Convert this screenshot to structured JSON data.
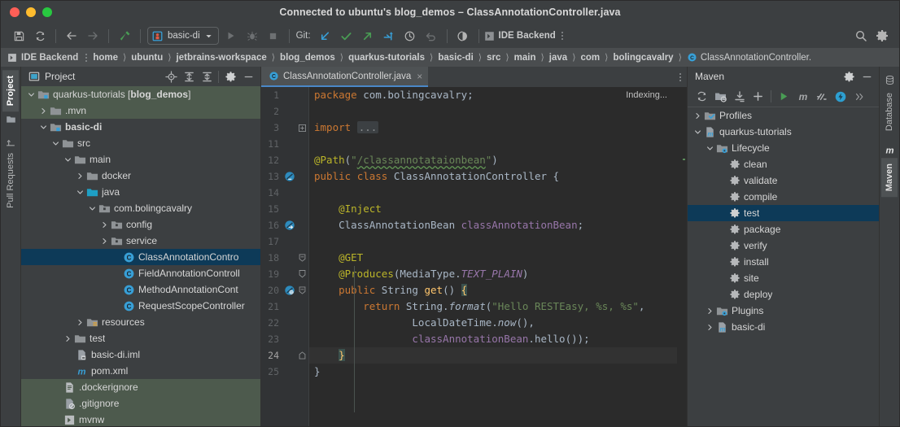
{
  "window": {
    "title": "Connected to ubuntu's blog_demos – ClassAnnotationController.java",
    "traffic_lights": [
      "close",
      "minimize",
      "zoom"
    ]
  },
  "toolbar": {
    "save_label": "save-all-icon",
    "sync_label": "sync-icon",
    "back_label": "back-arrow-icon",
    "forward_label": "forward-arrow-icon",
    "build_label": "build-hammer-icon",
    "run_config": "basic-di",
    "run_label": "run-icon",
    "debug_label": "debug-icon",
    "stop_label": "stop-icon",
    "git_label": "Git:",
    "git_update": "update-project-icon",
    "git_commit": "commit-icon",
    "git_push": "push-icon",
    "git_rebase": "rebase-icon",
    "history_label": "history-icon",
    "rollback_label": "rollback-icon",
    "coverage_label": "run-with-coverage-icon",
    "ide_backend": "IDE Backend",
    "search_label": "search-icon",
    "settings_label": "gear-icon"
  },
  "navbar": {
    "ide_backend": "IDE Backend",
    "crumbs": [
      {
        "label": "home",
        "bold": true
      },
      {
        "label": "ubuntu",
        "bold": true
      },
      {
        "label": "jetbrains-workspace",
        "bold": true
      },
      {
        "label": "blog_demos",
        "bold": true
      },
      {
        "label": "quarkus-tutorials",
        "bold": true
      },
      {
        "label": "basic-di",
        "bold": true
      },
      {
        "label": "src",
        "bold": true
      },
      {
        "label": "main",
        "bold": true
      },
      {
        "label": "java",
        "bold": true
      },
      {
        "label": "com",
        "bold": true
      },
      {
        "label": "bolingcavalry",
        "bold": true
      }
    ],
    "file": "ClassAnnotationController."
  },
  "left_strip": {
    "tabs": [
      {
        "label": "Project",
        "active": true,
        "icon": "project-icon"
      },
      {
        "label": "Pull Requests",
        "active": false,
        "icon": "pull-request-icon"
      }
    ]
  },
  "right_strip": {
    "tabs": [
      {
        "label": "Database",
        "active": false,
        "icon": "database-icon"
      },
      {
        "label": "Maven",
        "active": true,
        "icon": "maven-m-icon"
      }
    ]
  },
  "project_panel": {
    "title": "Project",
    "actions": [
      "locate-icon",
      "expand-all-icon",
      "collapse-all-icon",
      "gear-icon",
      "minimize-icon"
    ],
    "tree": [
      {
        "label": "quarkus-tutorials [blog_demos]",
        "bold_part": "blog_demos",
        "indent": 0,
        "arrow": "down",
        "icon": "module-folder-icon",
        "state": "modified"
      },
      {
        "label": ".mvn",
        "indent": 1,
        "arrow": "right",
        "icon": "folder-icon",
        "state": "modified"
      },
      {
        "label": "basic-di",
        "indent": 1,
        "arrow": "down",
        "icon": "module-folder-icon",
        "state": "bold"
      },
      {
        "label": "src",
        "indent": 2,
        "arrow": "down",
        "icon": "folder-icon",
        "state": "normal"
      },
      {
        "label": "main",
        "indent": 3,
        "arrow": "down",
        "icon": "folder-icon",
        "state": "normal"
      },
      {
        "label": "docker",
        "indent": 4,
        "arrow": "right",
        "icon": "folder-icon",
        "state": "normal"
      },
      {
        "label": "java",
        "indent": 4,
        "arrow": "down",
        "icon": "source-root-icon",
        "state": "normal"
      },
      {
        "label": "com.bolingcavalry",
        "indent": 5,
        "arrow": "down",
        "icon": "package-icon",
        "state": "normal"
      },
      {
        "label": "config",
        "indent": 6,
        "arrow": "right",
        "icon": "package-icon",
        "state": "normal"
      },
      {
        "label": "service",
        "indent": 6,
        "arrow": "right",
        "icon": "package-icon",
        "state": "normal"
      },
      {
        "label": "ClassAnnotationContro",
        "indent": 7,
        "arrow": "none",
        "icon": "java-class-icon",
        "state": "selected"
      },
      {
        "label": "FieldAnnotationControll",
        "indent": 7,
        "arrow": "none",
        "icon": "java-class-icon",
        "state": "normal"
      },
      {
        "label": "MethodAnnotationCont",
        "indent": 7,
        "arrow": "none",
        "icon": "java-class-icon",
        "state": "normal"
      },
      {
        "label": "RequestScopeController",
        "indent": 7,
        "arrow": "none",
        "icon": "java-class-icon",
        "state": "normal"
      },
      {
        "label": "resources",
        "indent": 4,
        "arrow": "right",
        "icon": "resource-root-icon",
        "state": "normal"
      },
      {
        "label": "test",
        "indent": 3,
        "arrow": "right",
        "icon": "folder-icon",
        "state": "normal"
      },
      {
        "label": "basic-di.iml",
        "indent": 3,
        "arrow": "none",
        "icon": "iml-file-icon",
        "state": "normal"
      },
      {
        "label": "pom.xml",
        "indent": 3,
        "arrow": "none",
        "icon": "maven-pom-icon",
        "state": "normal"
      },
      {
        "label": ".dockerignore",
        "indent": 2,
        "arrow": "none",
        "icon": "text-file-icon",
        "state": "modified"
      },
      {
        "label": ".gitignore",
        "indent": 2,
        "arrow": "none",
        "icon": "gitignore-file-icon",
        "state": "modified"
      },
      {
        "label": "mvnw",
        "indent": 2,
        "arrow": "none",
        "icon": "script-file-icon",
        "state": "modified"
      }
    ]
  },
  "editor": {
    "tab": {
      "title": "ClassAnnotationController.java",
      "icon": "java-class-icon",
      "close": "×"
    },
    "status": "Indexing...",
    "lines": [
      {
        "num": "1",
        "marker": "",
        "fold": "",
        "current": false,
        "html": "<span class=\"kw\">package</span> com.bolingcavalry;"
      },
      {
        "num": "2",
        "marker": "",
        "fold": "",
        "current": false,
        "html": ""
      },
      {
        "num": "3",
        "marker": "",
        "fold": "plus",
        "current": false,
        "html": "<span class=\"kw\">import</span> <span class=\"fold-ph\">...</span>"
      },
      {
        "num": "11",
        "marker": "",
        "fold": "",
        "current": false,
        "html": ""
      },
      {
        "num": "12",
        "marker": "",
        "fold": "",
        "current": false,
        "html": "<span class=\"ann\">@Path</span>(<span class=\"str\">\"</span><span class=\"str wavy\">/classannotataionbean</span><span class=\"str\">\"</span>)"
      },
      {
        "num": "13",
        "marker": "bean",
        "fold": "",
        "current": false,
        "html": "<span class=\"kw\">public</span> <span class=\"kw\">class</span> ClassAnnotationController {"
      },
      {
        "num": "14",
        "marker": "",
        "fold": "",
        "current": false,
        "html": ""
      },
      {
        "num": "15",
        "marker": "",
        "fold": "",
        "current": false,
        "html": "    <span class=\"ann\">@Inject</span>"
      },
      {
        "num": "16",
        "marker": "inject",
        "fold": "",
        "current": false,
        "html": "    ClassAnnotationBean <span class=\"fld\">classAnnotationBean</span>;"
      },
      {
        "num": "17",
        "marker": "",
        "fold": "",
        "current": false,
        "html": ""
      },
      {
        "num": "18",
        "marker": "",
        "fold": "open",
        "current": false,
        "html": "    <span class=\"ann\">@GET</span>"
      },
      {
        "num": "19",
        "marker": "",
        "fold": "mid",
        "current": false,
        "html": "    <span class=\"ann\">@Produces</span>(MediaType.<span class=\"sfield\">TEXT_PLAIN</span>)"
      },
      {
        "num": "20",
        "marker": "endpoint",
        "fold": "open",
        "current": false,
        "html": "    <span class=\"kw\">public</span> String <span class=\"mth\">get</span>() <span class=\"brace-hl\">{</span>"
      },
      {
        "num": "21",
        "marker": "",
        "fold": "",
        "current": false,
        "html": "        <span class=\"kw\">return</span> String.<span class=\"mi\">format</span>(<span class=\"str\">\"Hello RESTEasy, %s, %s\"</span>,"
      },
      {
        "num": "22",
        "marker": "",
        "fold": "",
        "current": false,
        "html": "                LocalDateTime.<span class=\"mi\">now</span>(),"
      },
      {
        "num": "23",
        "marker": "",
        "fold": "",
        "current": false,
        "html": "                <span class=\"fld\">classAnnotationBean</span>.hello());"
      },
      {
        "num": "24",
        "marker": "",
        "fold": "close",
        "current": true,
        "html": "    <span class=\"brace-hl\">}</span>"
      },
      {
        "num": "25",
        "marker": "",
        "fold": "",
        "current": false,
        "html": "}"
      }
    ]
  },
  "maven_panel": {
    "title": "Maven",
    "header_actions": [
      "gear-icon",
      "minimize-icon"
    ],
    "toolbar_actions": [
      "reload-icon",
      "add-maven-project-icon",
      "download-sources-icon",
      "add-icon",
      "run-icon",
      "maven-goal-icon",
      "toggle-skip-tests-icon",
      "execute-icon",
      "more-icon"
    ],
    "tree": [
      {
        "label": "Profiles",
        "indent": 0,
        "arrow": "right",
        "icon": "profiles-icon",
        "state": "normal"
      },
      {
        "label": "quarkus-tutorials",
        "indent": 0,
        "arrow": "down",
        "icon": "maven-project-icon",
        "state": "normal"
      },
      {
        "label": "Lifecycle",
        "indent": 1,
        "arrow": "down",
        "icon": "lifecycle-folder-icon",
        "state": "normal"
      },
      {
        "label": "clean",
        "indent": 2,
        "arrow": "none",
        "icon": "maven-goal-gear-icon",
        "state": "normal"
      },
      {
        "label": "validate",
        "indent": 2,
        "arrow": "none",
        "icon": "maven-goal-gear-icon",
        "state": "normal"
      },
      {
        "label": "compile",
        "indent": 2,
        "arrow": "none",
        "icon": "maven-goal-gear-icon",
        "state": "normal"
      },
      {
        "label": "test",
        "indent": 2,
        "arrow": "none",
        "icon": "maven-goal-gear-icon",
        "state": "selected"
      },
      {
        "label": "package",
        "indent": 2,
        "arrow": "none",
        "icon": "maven-goal-gear-icon",
        "state": "normal"
      },
      {
        "label": "verify",
        "indent": 2,
        "arrow": "none",
        "icon": "maven-goal-gear-icon",
        "state": "normal"
      },
      {
        "label": "install",
        "indent": 2,
        "arrow": "none",
        "icon": "maven-goal-gear-icon",
        "state": "normal"
      },
      {
        "label": "site",
        "indent": 2,
        "arrow": "none",
        "icon": "maven-goal-gear-icon",
        "state": "normal"
      },
      {
        "label": "deploy",
        "indent": 2,
        "arrow": "none",
        "icon": "maven-goal-gear-icon",
        "state": "normal"
      },
      {
        "label": "Plugins",
        "indent": 0,
        "arrow": "right",
        "icon": "plugins-folder-icon",
        "state": "normal"
      },
      {
        "label": "basic-di",
        "indent": 0,
        "arrow": "right",
        "icon": "maven-project-icon",
        "state": "normal"
      }
    ]
  },
  "colors": {
    "accent_blue": "#4a88c7",
    "selection_blue": "#0d3a58",
    "modified_green": "#4d5a4d",
    "editor_bg": "#2b2b2b",
    "panel_bg": "#3c3f41",
    "cyan": "#389fd6",
    "green": "#499c54"
  }
}
